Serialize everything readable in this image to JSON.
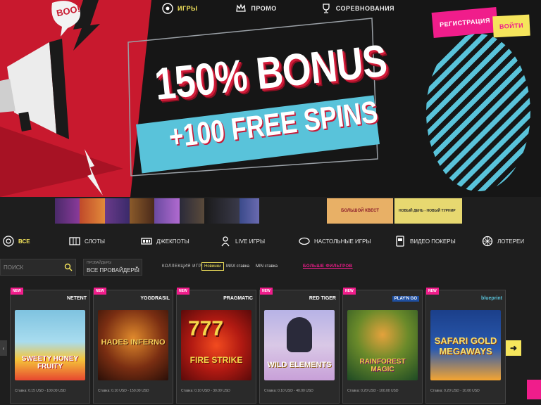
{
  "hero": {
    "comic_text": "BOO!",
    "bonus_line": "150% BONUS",
    "spins_line": "+100 FREE SPINS",
    "colors": {
      "red": "#d41c3a",
      "cyan": "#59c3da",
      "pink": "#f01d8b",
      "yellow": "#f5e55c"
    }
  },
  "nav": {
    "items": [
      {
        "label": "ИГРЫ",
        "icon": "games-icon",
        "active": true
      },
      {
        "label": "ПРОМО",
        "icon": "crown-icon",
        "active": false
      },
      {
        "label": "СОРЕВНОВАНИЯ",
        "icon": "trophy-icon",
        "active": false
      }
    ]
  },
  "auth": {
    "register_label": "РЕГИСТРАЦИЯ",
    "login_label": "ВОЙТИ"
  },
  "promo_banners": {
    "left": [
      "banner-1",
      "banner-2",
      "banner-3",
      "banner-4",
      "banner-5",
      "banner-6",
      "banner-7",
      "banner-8"
    ],
    "right": [
      {
        "text": "БОЛЬШОЙ КВЕСТ"
      },
      {
        "text": "НОВЫЙ ДЕНЬ - НОВЫЙ ТУРНИР"
      }
    ]
  },
  "categories": [
    {
      "label": "ВСЕ",
      "icon": "all-games-icon",
      "active": true
    },
    {
      "label": "СЛОТЫ",
      "icon": "slots-icon",
      "active": false
    },
    {
      "label": "ДЖЕКПОТЫ",
      "icon": "jackpot-icon",
      "active": false
    },
    {
      "label": "LIVE ИГРЫ",
      "icon": "live-dealer-icon",
      "active": false
    },
    {
      "label": "НАСТОЛЬНЫЕ ИГРЫ",
      "icon": "table-games-icon",
      "active": false
    },
    {
      "label": "ВИДЕО ПОКЕРЫ",
      "icon": "video-poker-icon",
      "active": false
    },
    {
      "label": "ЛОТЕРЕИ",
      "icon": "lottery-icon",
      "active": false
    }
  ],
  "filters": {
    "search_placeholder": "ПОИСК",
    "provider_caption": "ПРОВАЙДЕРЫ",
    "provider_value": "ВСЕ ПРОВАЙДЕРЫ",
    "collections_label": "КОЛЛЕКЦИЯ ИГР:",
    "chips": [
      {
        "label": "Новинки",
        "active": true
      },
      {
        "label": "MAX ставка",
        "active": false
      },
      {
        "label": "MIN ставка",
        "active": false
      }
    ],
    "more_label": "БОЛЬШЕ ФИЛЬТРОВ"
  },
  "games": [
    {
      "badge": "NEW",
      "provider": "NETENT",
      "title": "SWEETY HONEY FRUITY",
      "bet": "Ставка: 0.15 USD - 100.00 USD",
      "palette": [
        "#7fc3e0",
        "#f5c63a",
        "#e7472f"
      ]
    },
    {
      "badge": "NEW",
      "provider": "YGGDRASIL",
      "title": "HADES INFERNO",
      "bet": "Ставка: 0.10 USD - 150.00 USD",
      "palette": [
        "#3a1a10",
        "#e08a2c",
        "#f5d05a"
      ]
    },
    {
      "badge": "NEW",
      "provider": "PRAGMATIC",
      "title": "FIRE STRIKE",
      "bet": "Ставка: 0.10 USD - 30.00 USD",
      "palette": [
        "#7a0f12",
        "#f24b1f",
        "#f5d74a"
      ]
    },
    {
      "badge": "NEW",
      "provider": "RED TIGER",
      "title": "WILD ELEMENTS",
      "bet": "Ставка: 0.10 USD - 40.00 USD",
      "palette": [
        "#b7b3e6",
        "#f0d0a0",
        "#d8a72f"
      ]
    },
    {
      "badge": "NEW",
      "provider": "PLAY'N GO",
      "title": "RAINFOREST MAGIC",
      "bet": "Ставка: 0.20 USD - 100.00 USD",
      "palette": [
        "#2e6b3a",
        "#e4a23c",
        "#b83c84"
      ]
    },
    {
      "badge": "NEW",
      "provider": "blueprint",
      "title": "SAFARI GOLD MEGAWAYS",
      "bet": "Ставка: 0.20 USD - 10.00 USD",
      "palette": [
        "#1b3f8a",
        "#f5a531",
        "#f5e070"
      ]
    }
  ]
}
